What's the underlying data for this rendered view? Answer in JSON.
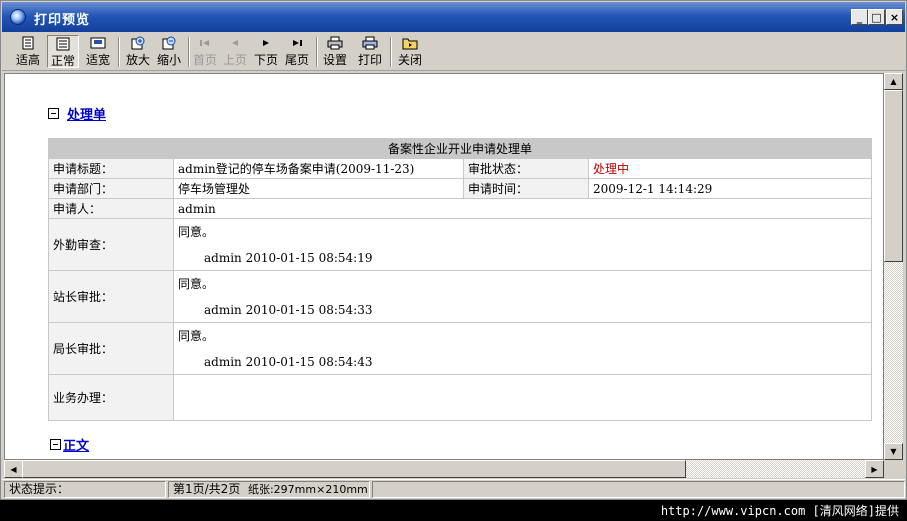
{
  "window": {
    "title": "打印预览"
  },
  "toolbar": {
    "buttons": [
      {
        "label": "适高",
        "icon": "fit-height-icon"
      },
      {
        "label": "正常",
        "icon": "normal-view-icon"
      },
      {
        "label": "适宽",
        "icon": "fit-width-icon"
      },
      {
        "label": "放大",
        "icon": "zoom-in-icon"
      },
      {
        "label": "缩小",
        "icon": "zoom-out-icon"
      },
      {
        "label": "首页",
        "icon": "first-page-icon"
      },
      {
        "label": "上页",
        "icon": "prev-page-icon"
      },
      {
        "label": "下页",
        "icon": "next-page-icon"
      },
      {
        "label": "尾页",
        "icon": "last-page-icon"
      },
      {
        "label": "设置",
        "icon": "printer-settings-icon"
      },
      {
        "label": "打印",
        "icon": "printer-icon"
      },
      {
        "label": "关闭",
        "icon": "close-folder-icon"
      }
    ]
  },
  "document": {
    "section1": {
      "title": "处理单"
    },
    "form": {
      "header": "备案性企业开业申请处理单",
      "rows": {
        "subject_label": "申请标题：",
        "subject_value": "admin登记的停车场备案申请(2009-11-23)",
        "status_label": "审批状态：",
        "status_value": "处理中",
        "dept_label": "申请部门：",
        "dept_value": "停车场管理处",
        "time_label": "申请时间：",
        "time_value": "2009-12-1 14:14:29",
        "applicant_label": "申请人：",
        "applicant_value": "admin"
      },
      "opinions": [
        {
          "label": "外勤审查：",
          "text": "同意。",
          "signature": "admin 2010-01-15 08:54:19"
        },
        {
          "label": "站长审批：",
          "text": "同意。",
          "signature": "admin 2010-01-15 08:54:33"
        },
        {
          "label": "局长审批：",
          "text": "同意。",
          "signature": "admin 2010-01-15 08:54:43"
        }
      ],
      "business_label": "业务办理："
    },
    "section2": {
      "title": "正文"
    }
  },
  "statusbar": {
    "hint": "状态提示：",
    "page": "第1页/共2页",
    "paper": "纸张:297mm×210mm"
  },
  "watermark": "http://www.vipcn.com [清风网络]提供"
}
